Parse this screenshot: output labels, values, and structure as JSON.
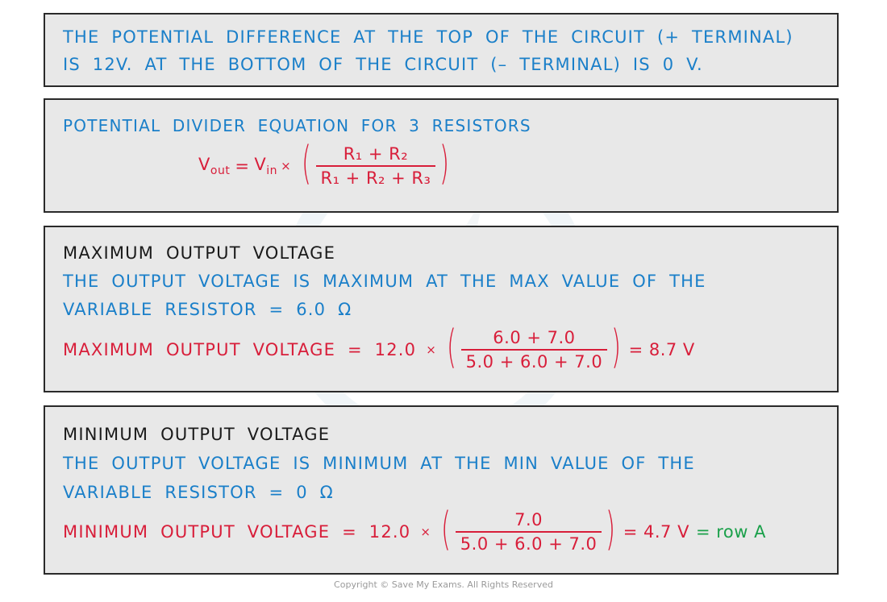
{
  "intro_box": {
    "line1": "THE POTENTIAL DIFFERENCE AT THE TOP OF THE CIRCUIT (+ TERMINAL)",
    "line2": "IS 12V. AT THE BOTTOM OF THE CIRCUIT (– TERMINAL) IS 0 V."
  },
  "equation_box": {
    "heading": "POTENTIAL DIVIDER EQUATION FOR 3 RESISTORS",
    "lhs_main": "V",
    "lhs_sub": "out",
    "equals": "=",
    "vin_main": "V",
    "vin_sub": "in",
    "times": "×",
    "numerator": "R₁ + R₂",
    "denominator": "R₁ + R₂ + R₃"
  },
  "max_box": {
    "heading": "MAXIMUM OUTPUT VOLTAGE",
    "line1": "THE OUTPUT VOLTAGE IS MAXIMUM AT THE MAX VALUE OF THE",
    "line2": "VARIABLE RESISTOR = 6.0 Ω",
    "calc_label": "MAXIMUM OUTPUT VOLTAGE = 12.0",
    "times": "×",
    "numerator": "6.0 + 7.0",
    "denominator": "5.0 + 6.0 + 7.0",
    "result": "= 8.7 V"
  },
  "min_box": {
    "heading": "MINIMUM OUTPUT VOLTAGE",
    "line1": "THE OUTPUT VOLTAGE IS MINIMUM AT THE MIN VALUE OF THE",
    "line2": "VARIABLE RESISTOR = 0 Ω",
    "calc_label": "MINIMUM OUTPUT VOLTAGE = 12.0",
    "times": "×",
    "numerator": "7.0",
    "denominator": "5.0 + 6.0 + 7.0",
    "result": "= 4.7 V",
    "answer": "= row A"
  },
  "footer": {
    "copyright": "Copyright © Save My Exams. All Rights Reserved"
  },
  "colors": {
    "blue_text": "#1a7fc9",
    "red_text": "#d81e3a",
    "green_text": "#1aa04a",
    "black_text": "#1a1a1a",
    "box_fill": "#e8e8e8"
  }
}
